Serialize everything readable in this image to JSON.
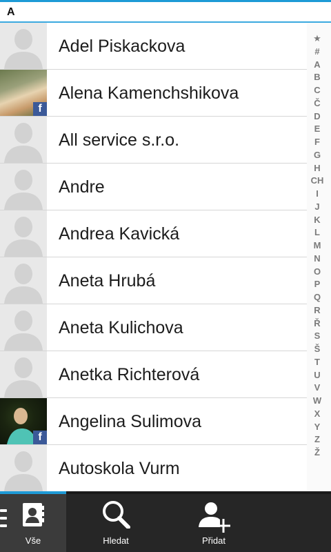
{
  "section_header": "A",
  "contacts": [
    {
      "name": "Adel Piskackova",
      "avatar": "placeholder",
      "facebook": false
    },
    {
      "name": "Alena Kamenchshikova",
      "avatar": "photo1",
      "facebook": true
    },
    {
      "name": "All service s.r.o.",
      "avatar": "placeholder",
      "facebook": false
    },
    {
      "name": "Andre",
      "avatar": "placeholder",
      "facebook": false
    },
    {
      "name": "Andrea Kavická",
      "avatar": "placeholder",
      "facebook": false
    },
    {
      "name": "Aneta Hrubá",
      "avatar": "placeholder",
      "facebook": false
    },
    {
      "name": "Aneta Kulichova",
      "avatar": "placeholder",
      "facebook": false
    },
    {
      "name": "Anetka Richterová",
      "avatar": "placeholder",
      "facebook": false
    },
    {
      "name": "Angelina Sulimova",
      "avatar": "photo2",
      "facebook": true
    },
    {
      "name": "Autoskola Vurm",
      "avatar": "placeholder",
      "facebook": false
    }
  ],
  "facebook_badge": "f",
  "alpha_index": [
    "★",
    "#",
    "A",
    "B",
    "C",
    "Č",
    "D",
    "E",
    "F",
    "G",
    "H",
    "CH",
    "I",
    "J",
    "K",
    "L",
    "M",
    "N",
    "O",
    "P",
    "Q",
    "R",
    "Ř",
    "S",
    "Š",
    "T",
    "U",
    "V",
    "W",
    "X",
    "Y",
    "Z",
    "Ž"
  ],
  "tabs": [
    {
      "label": "Vše",
      "icon": "contacts-book-icon"
    },
    {
      "label": "Hledat",
      "icon": "search-icon"
    },
    {
      "label": "Přidat",
      "icon": "add-contact-icon"
    }
  ],
  "colors": {
    "accent": "#1e9ad6",
    "facebook": "#3b5998",
    "bottom_bar": "#262626"
  }
}
